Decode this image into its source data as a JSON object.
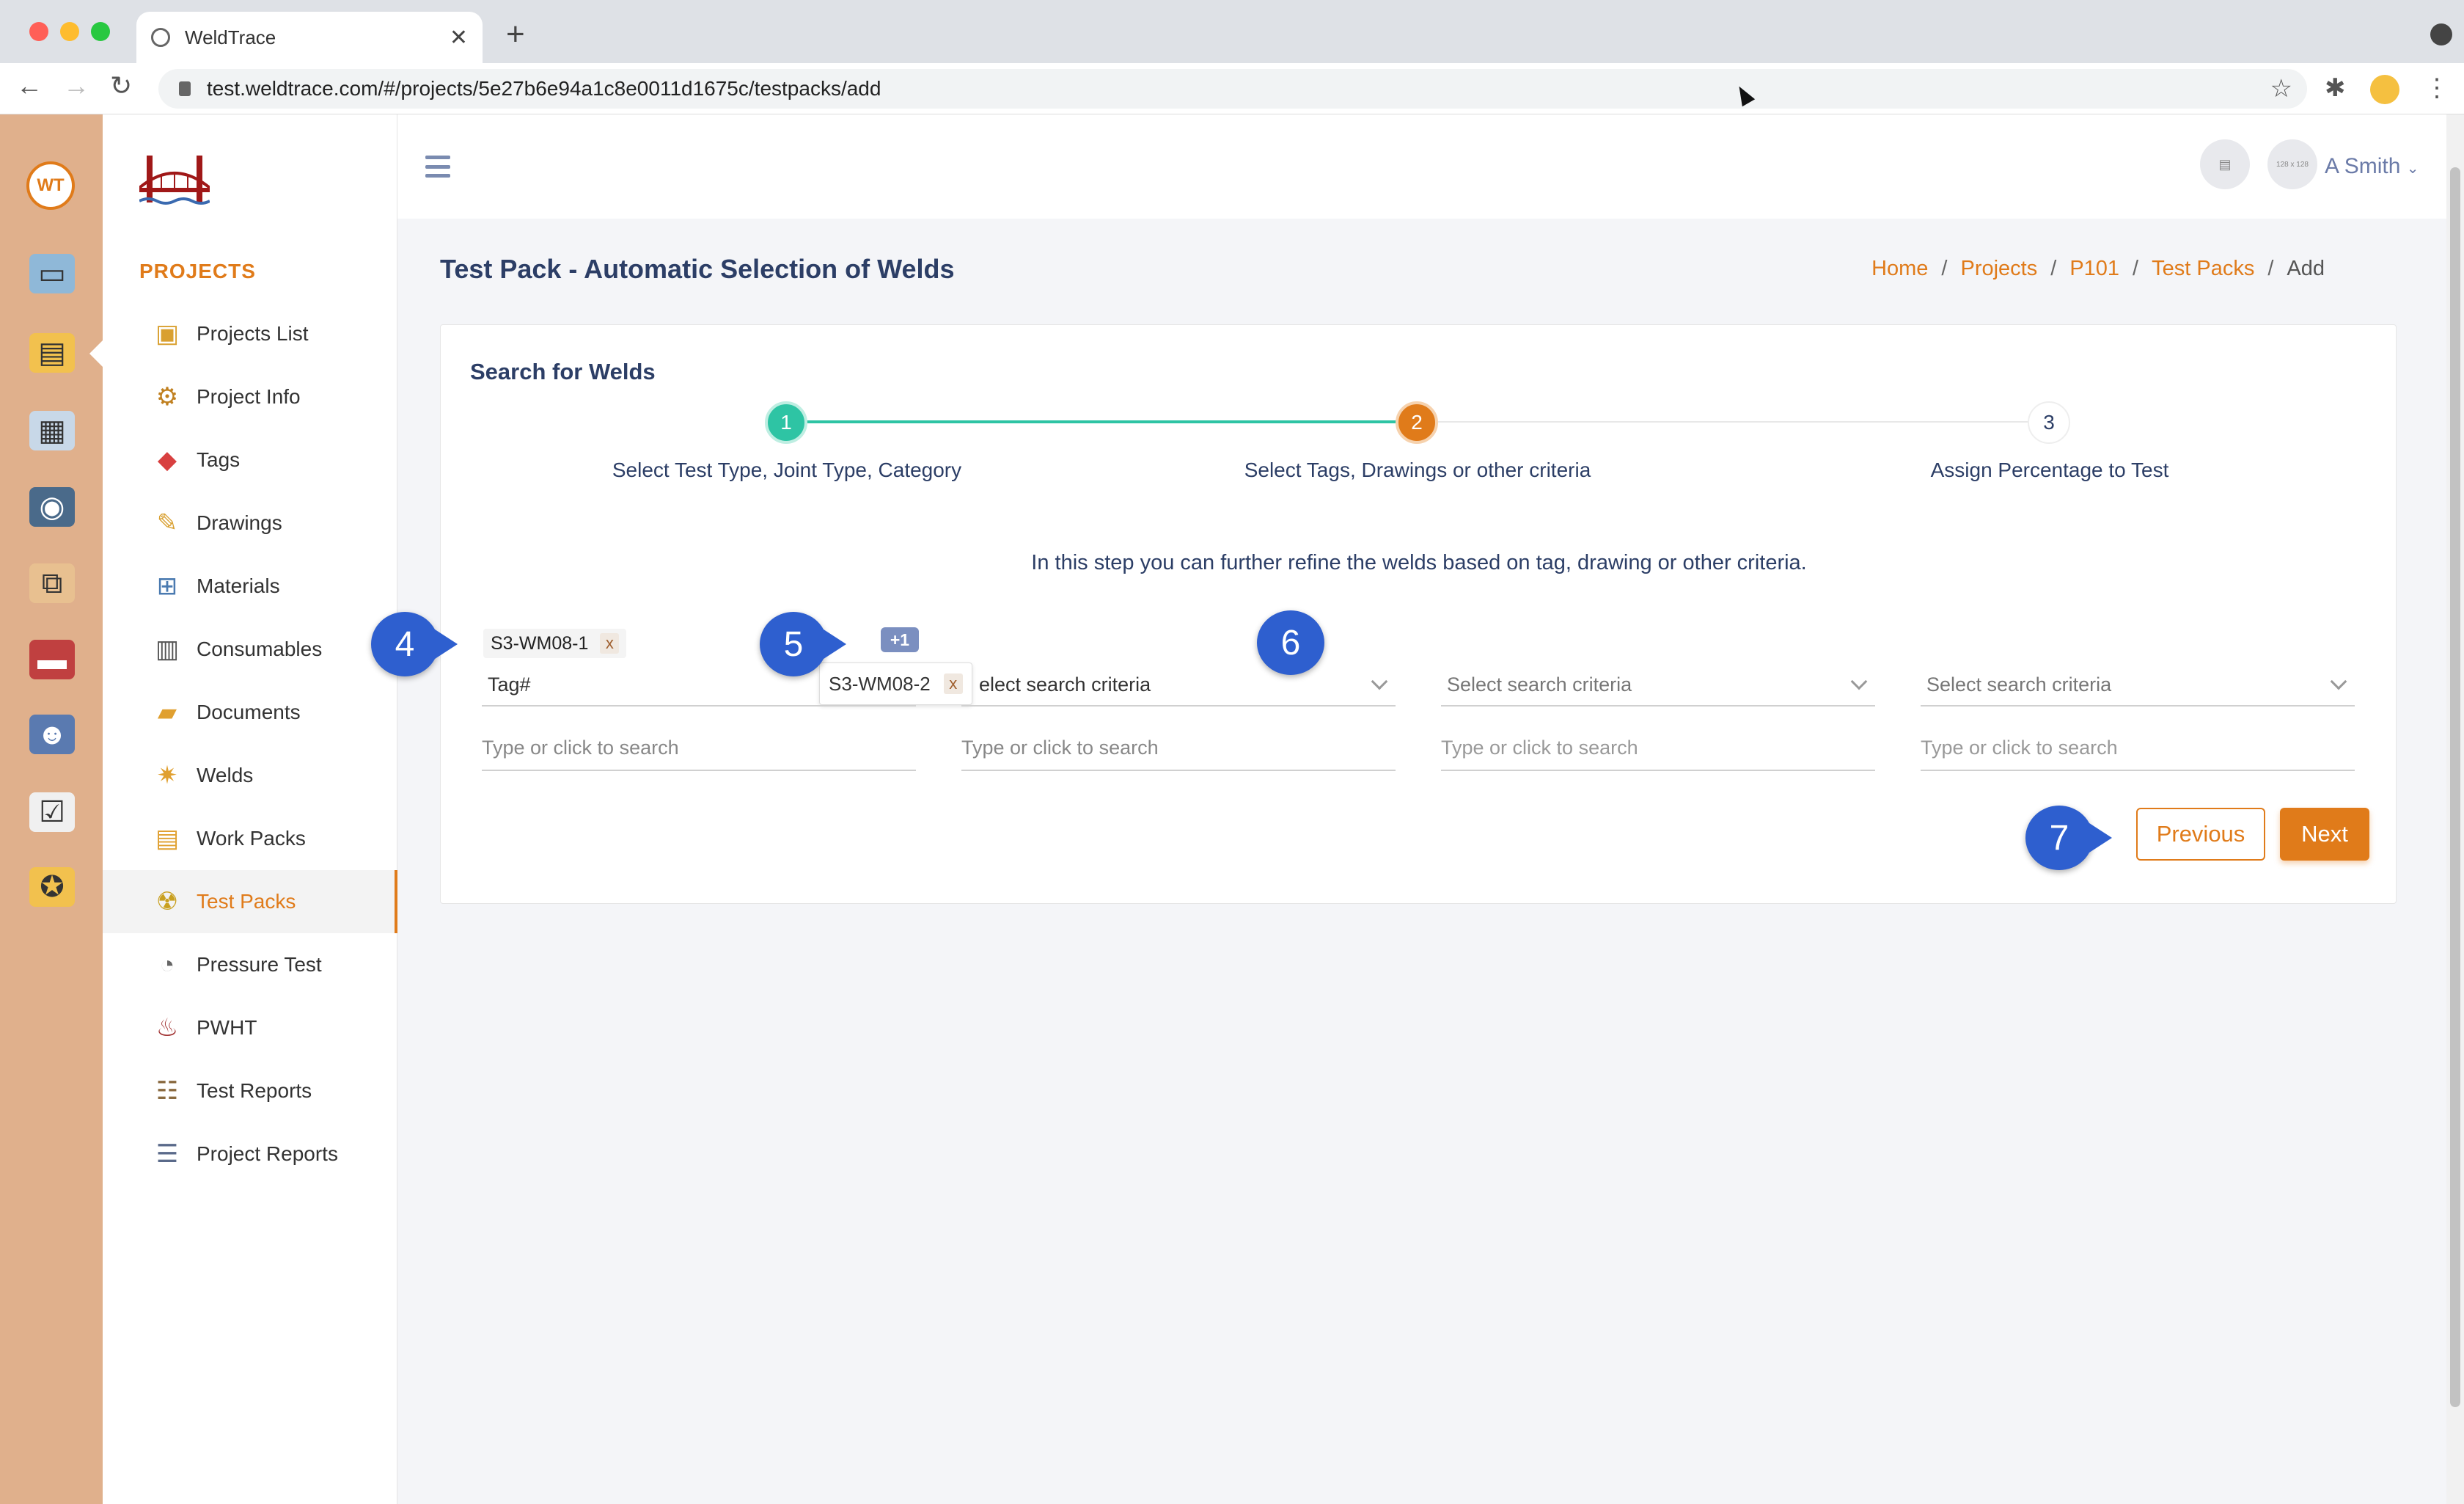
{
  "browser": {
    "tab_title": "WeldTrace",
    "url": "test.weldtrace.com/#/projects/5e27b6e94a1c8e0011d1675c/testpacks/add",
    "new_tab": "+",
    "tab_close": "✕"
  },
  "rail": {
    "logo_text": "WT",
    "icons": [
      "monitor-icon",
      "folder-settings-icon",
      "clipboard-gear-icon",
      "welder-icon",
      "org-chart-icon",
      "book-icon",
      "team-icon",
      "checklist-clock-icon",
      "certificate-icon"
    ]
  },
  "sidebar": {
    "section_title": "PROJECTS",
    "items": [
      {
        "label": "Projects List",
        "icon": "camera-folder-icon"
      },
      {
        "label": "Project Info",
        "icon": "gears-icon"
      },
      {
        "label": "Tags",
        "icon": "tag-icon"
      },
      {
        "label": "Drawings",
        "icon": "drawing-tools-icon"
      },
      {
        "label": "Materials",
        "icon": "pipes-icon"
      },
      {
        "label": "Consumables",
        "icon": "barrel-icon"
      },
      {
        "label": "Documents",
        "icon": "folder-icon"
      },
      {
        "label": "Welds",
        "icon": "weld-spark-icon"
      },
      {
        "label": "Work Packs",
        "icon": "package-icon"
      },
      {
        "label": "Test Packs",
        "icon": "radiation-icon",
        "active": true
      },
      {
        "label": "Pressure Test",
        "icon": "gauge-icon"
      },
      {
        "label": "PWHT",
        "icon": "heater-icon"
      },
      {
        "label": "Test Reports",
        "icon": "report-icon"
      },
      {
        "label": "Project Reports",
        "icon": "project-report-icon"
      }
    ]
  },
  "topbar": {
    "avatar_placeholder": "128 x 128",
    "user_name": "A Smith"
  },
  "page": {
    "title": "Test Pack - Automatic Selection of Welds",
    "breadcrumb": [
      "Home",
      "Projects",
      "P101",
      "Test Packs",
      "Add"
    ],
    "breadcrumb_sep": "/"
  },
  "wizard": {
    "card_title": "Search for Welds",
    "steps": [
      {
        "number": "1",
        "label": "Select Test Type, Joint Type, Category",
        "state": "done"
      },
      {
        "number": "2",
        "label": "Select Tags, Drawings or other criteria",
        "state": "current"
      },
      {
        "number": "3",
        "label": "Assign Percentage to Test",
        "state": "todo"
      }
    ],
    "info_text": "In this step you can further refine the welds based on tag, drawing or other criteria.",
    "chips": {
      "first": "S3-WM08-1",
      "more_badge": "+1",
      "tooltip_value": "S3-WM08-2",
      "remove": "x"
    },
    "criteria": [
      {
        "select": "Tag#",
        "search_placeholder": "Type or click to search"
      },
      {
        "select": "elect search criteria",
        "search_placeholder": "Type or click to search"
      },
      {
        "select": "Select search criteria",
        "search_placeholder": "Type or click to search"
      },
      {
        "select": "Select search criteria",
        "search_placeholder": "Type or click to search"
      }
    ],
    "buttons": {
      "previous": "Previous",
      "next": "Next"
    }
  },
  "callouts": [
    "4",
    "5",
    "6",
    "7"
  ],
  "colors": {
    "accent": "#e07b1a",
    "done": "#2ec4a4",
    "rail": "#e0b08c",
    "callout": "#2e5fcf",
    "title": "#2c3e66"
  }
}
